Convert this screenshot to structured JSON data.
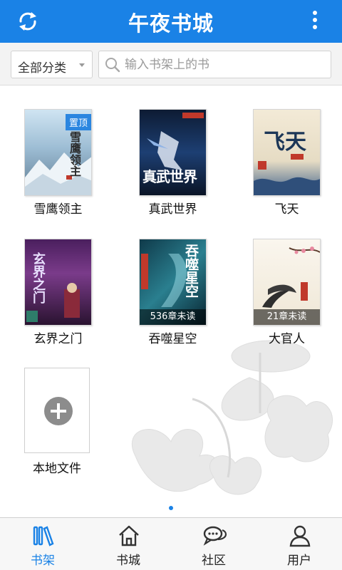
{
  "header": {
    "title": "午夜书城",
    "refresh_icon": "refresh-icon",
    "menu_icon": "more-vertical-icon"
  },
  "filter": {
    "category_label": "全部分类",
    "search_placeholder": "输入书架上的书"
  },
  "books": [
    {
      "title": "雪鹰领主",
      "badge": "置顶",
      "cover_text": "雪鹰领主"
    },
    {
      "title": "真武世界",
      "cover_text": "真武世界"
    },
    {
      "title": "飞天",
      "cover_text": "飞天"
    },
    {
      "title": "玄界之门",
      "cover_text": "玄界之门"
    },
    {
      "title": "吞噬星空",
      "progress": "536章未读",
      "cover_text": "吞噬星空"
    },
    {
      "title": "大官人",
      "progress": "21章未读"
    }
  ],
  "add_local": {
    "label": "本地文件",
    "icon": "plus-circle-icon"
  },
  "tabs": [
    {
      "label": "书架",
      "icon": "bookshelf-icon",
      "active": true
    },
    {
      "label": "书城",
      "icon": "home-icon",
      "active": false
    },
    {
      "label": "社区",
      "icon": "chat-bubbles-icon",
      "active": false
    },
    {
      "label": "用户",
      "icon": "user-icon",
      "active": false
    }
  ],
  "colors": {
    "primary": "#1a82e6",
    "filter_bg": "#f3f3f3",
    "tab_active": "#1a82e6"
  }
}
